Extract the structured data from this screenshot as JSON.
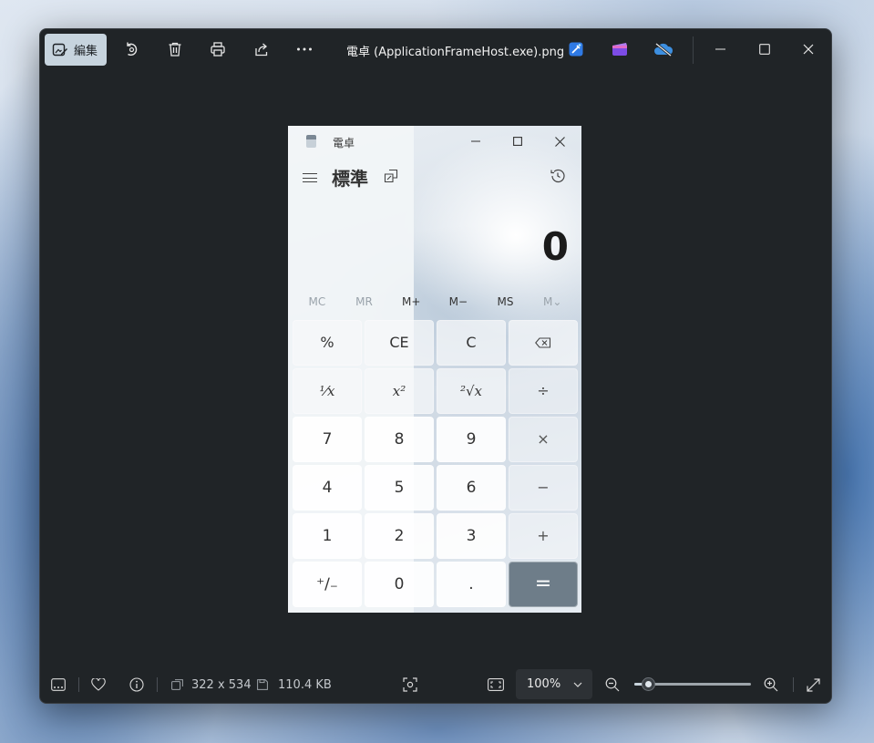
{
  "toolbar": {
    "edit_label": "編集",
    "file_title": "電卓 (ApplicationFrameHost.exe).png"
  },
  "calculator": {
    "window_title": "電卓",
    "mode": "標準",
    "display": "0",
    "memory": [
      "MC",
      "MR",
      "M+",
      "M−",
      "MS",
      "M⌄"
    ],
    "keys": {
      "percent": "%",
      "ce": "CE",
      "c": "C",
      "backspace": "⌫",
      "reciprocal": "⅟x",
      "square": "x²",
      "sqrt": "²√x",
      "divide": "÷",
      "k7": "7",
      "k8": "8",
      "k9": "9",
      "multiply": "×",
      "k4": "4",
      "k5": "5",
      "k6": "6",
      "minus": "−",
      "k1": "1",
      "k2": "2",
      "k3": "3",
      "plus": "+",
      "negate": "⁺∕₋",
      "k0": "0",
      "decimal": ".",
      "equals": "="
    }
  },
  "statusbar": {
    "dimensions": "322 x 534",
    "file_size": "110.4 KB",
    "zoom": "100%",
    "zoom_level": 0.12
  }
}
